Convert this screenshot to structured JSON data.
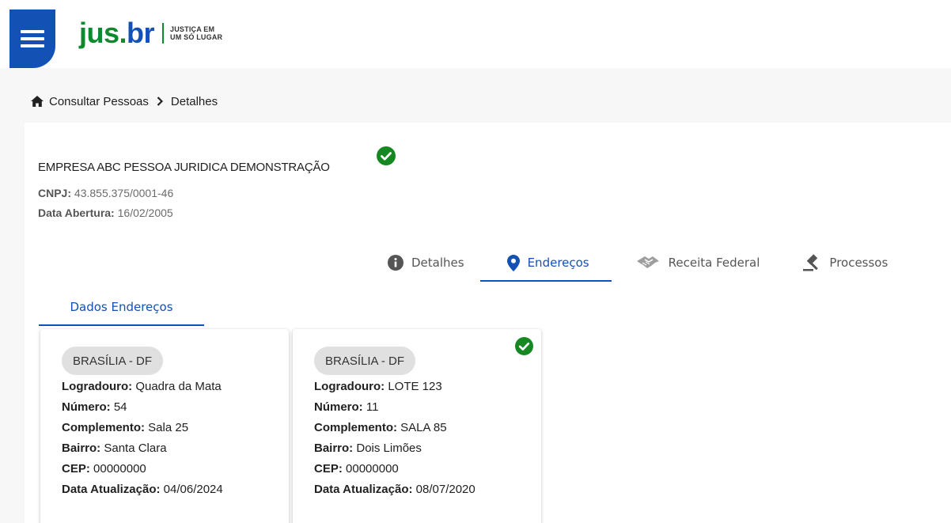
{
  "header": {
    "logo_jus": "jus",
    "logo_dot": ".",
    "logo_br": "br",
    "tagline_line1": "JUSTIÇA EM",
    "tagline_line2": "UM SÓ LUGAR"
  },
  "breadcrumb": {
    "items": [
      "Consultar Pessoas",
      "Detalhes"
    ]
  },
  "company": {
    "name": "EMPRESA ABC PESSOA JURIDICA DEMONSTRAÇÃO",
    "cnpj_label": "CNPJ:",
    "cnpj_value": "43.855.375/0001-46",
    "abertura_label": "Data Abertura:",
    "abertura_value": "16/02/2005"
  },
  "tabs": [
    {
      "label": "Detalhes",
      "icon": "info-circle-icon",
      "active": false
    },
    {
      "label": "Endereços",
      "icon": "map-pin-icon",
      "active": true
    },
    {
      "label": "Receita Federal",
      "icon": "receita-federal-icon",
      "active": false
    },
    {
      "label": "Processos",
      "icon": "gavel-icon",
      "active": false
    }
  ],
  "subtab": {
    "label": "Dados Endereços"
  },
  "labels": {
    "logradouro": "Logradouro:",
    "numero": "Número:",
    "complemento": "Complemento:",
    "bairro": "Bairro:",
    "cep": "CEP:",
    "atualizacao": "Data Atualização:"
  },
  "addresses": [
    {
      "city": "BRASÍLIA - DF",
      "logradouro": "Quadra da Mata",
      "numero": "54",
      "complemento": "Sala 25",
      "bairro": "Santa Clara",
      "cep": "00000000",
      "atualizacao": "04/06/2024",
      "verified": false
    },
    {
      "city": "BRASÍLIA - DF",
      "logradouro": "LOTE 123",
      "numero": "11",
      "complemento": "SALA 85",
      "bairro": "Dois Limões",
      "cep": "00000000",
      "atualizacao": "08/07/2020",
      "verified": true
    }
  ],
  "colors": {
    "primary": "#1351b4",
    "success": "#168821",
    "logo_green": "#0b8a2e"
  }
}
